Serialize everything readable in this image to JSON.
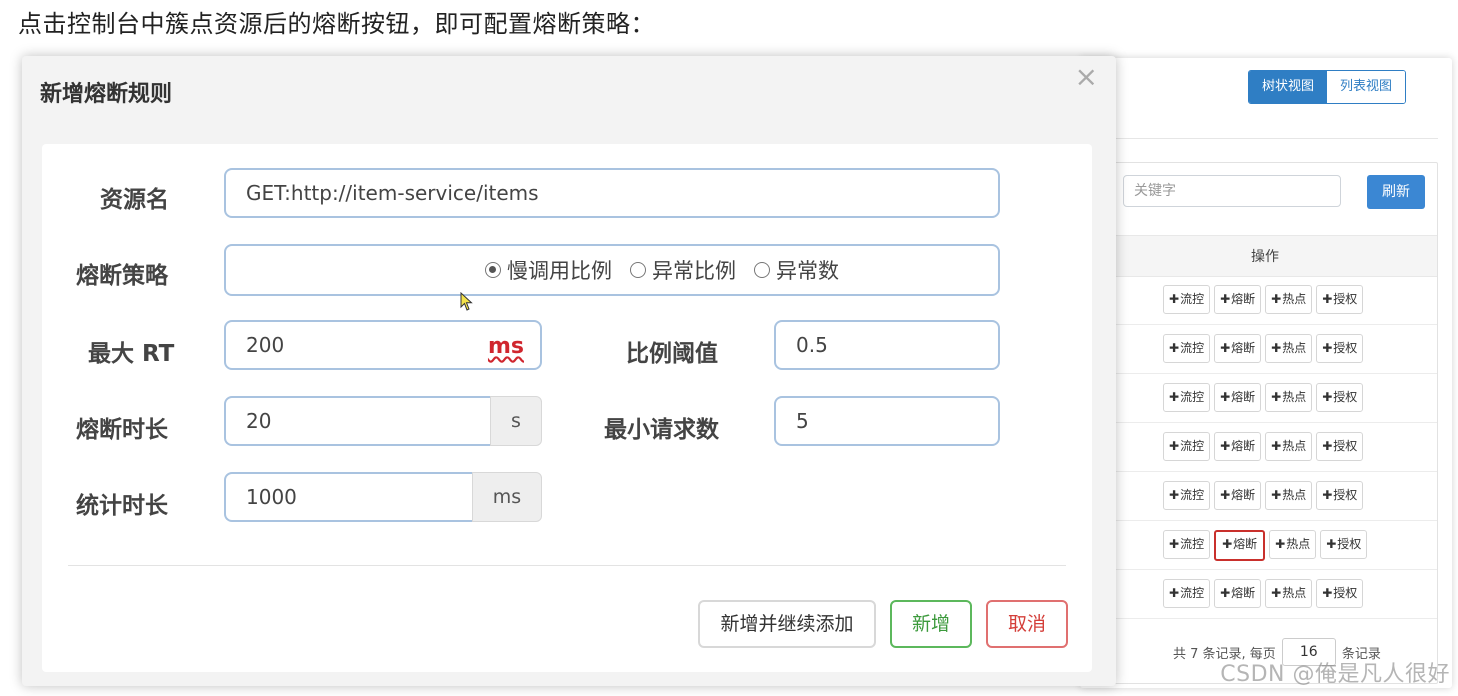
{
  "caption": "点击控制台中簇点资源后的熔断按钮，即可配置熔断策略：",
  "console": {
    "view_tree": "树状视图",
    "view_list": "列表视图",
    "keyword_placeholder": "关键字",
    "refresh": "刷新",
    "ops_header": "操作",
    "op_plus": "✚",
    "ops": {
      "flow": "流控",
      "degrade": "熔断",
      "hot": "热点",
      "auth": "授权"
    },
    "row_count": 7,
    "highlighted_row": 6,
    "pager": {
      "prefix": "共 7 条记录, 每页",
      "page_size": "16",
      "suffix": "条记录"
    }
  },
  "modal": {
    "title": "新增熔断规则",
    "close": "×",
    "resource_label": "资源名",
    "resource_value": "GET:http://item-service/items",
    "strategy_label": "熔断策略",
    "strategies": [
      "慢调用比例",
      "异常比例",
      "异常数"
    ],
    "strategy_selected": 0,
    "max_rt_label": "最大 RT",
    "max_rt_value": "200",
    "max_rt_unit": "ms",
    "ratio_label": "比例阈值",
    "ratio_value": "0.5",
    "duration_label": "熔断时长",
    "duration_value": "20",
    "duration_unit": "s",
    "min_req_label": "最小请求数",
    "min_req_value": "5",
    "stat_label": "统计时长",
    "stat_value": "1000",
    "stat_unit": "ms",
    "btn_continue": "新增并继续添加",
    "btn_add": "新增",
    "btn_cancel": "取消"
  },
  "watermark": "CSDN @俺是凡人很好",
  "colors": {
    "primary": "#2f7ec4",
    "success": "#5cb85c",
    "danger": "#d43f3a",
    "field_border": "#a9c3e0"
  }
}
